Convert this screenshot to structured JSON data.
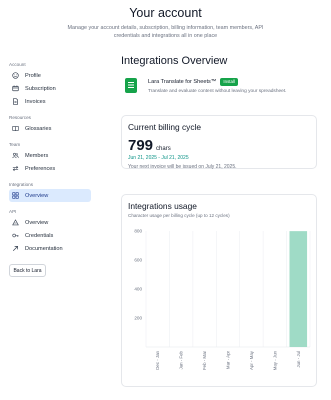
{
  "header": {
    "title": "Your account",
    "subtitle": "Manage your account details, subscription, billing information, team members, API credentials and integrations all in one place"
  },
  "sidebar": {
    "groups": [
      {
        "label": "Account",
        "items": [
          {
            "label": "Profile",
            "icon": "smile-icon"
          },
          {
            "label": "Subscription",
            "icon": "subscription-icon"
          },
          {
            "label": "Invoices",
            "icon": "document-icon"
          }
        ]
      },
      {
        "label": "Resources",
        "items": [
          {
            "label": "Glossaries",
            "icon": "book-icon"
          }
        ]
      },
      {
        "label": "Team",
        "items": [
          {
            "label": "Members",
            "icon": "users-icon"
          },
          {
            "label": "Preferences",
            "icon": "arrows-icon"
          }
        ]
      },
      {
        "label": "Integrations",
        "items": [
          {
            "label": "Overview",
            "icon": "grid-icon",
            "active": true
          }
        ]
      },
      {
        "label": "API",
        "items": [
          {
            "label": "Overview",
            "icon": "triangle-icon"
          },
          {
            "label": "Credentials",
            "icon": "key-icon"
          },
          {
            "label": "Documentation",
            "icon": "arrow-up-right-icon"
          }
        ]
      }
    ],
    "back_label": "Back to Lara"
  },
  "main": {
    "title": "Integrations Overview",
    "integration": {
      "name": "Lara Translate for Sheets™",
      "badge": "Install",
      "description": "Translate and evaluate content without leaving your spreadsheet."
    },
    "billing": {
      "title": "Current billing cycle",
      "amount": "799",
      "unit": "chars",
      "period": "Jun 21, 2025 - Jul 21, 2025",
      "next_invoice": "Your next invoice will be issued on July 21, 2025."
    },
    "usage": {
      "title": "Integrations usage",
      "description": "Character usage per billing cycle (up to 12 cycles)"
    }
  },
  "colors": {
    "accent_green": "#16a34a",
    "teal": "#0d9488",
    "bar": "#9fdbc6",
    "active_bg": "#dbeafe"
  },
  "chart_data": {
    "type": "bar",
    "categories": [
      "Dec - Jan",
      "Jan - Feb",
      "Feb - Mar",
      "Mar - Apr",
      "Apr - May",
      "May - Jun",
      "Jun - Jul"
    ],
    "values": [
      0,
      0,
      0,
      0,
      0,
      0,
      799
    ],
    "yticks": [
      200,
      400,
      600,
      800
    ],
    "ylim": [
      0,
      800
    ],
    "grid": "vertical"
  }
}
